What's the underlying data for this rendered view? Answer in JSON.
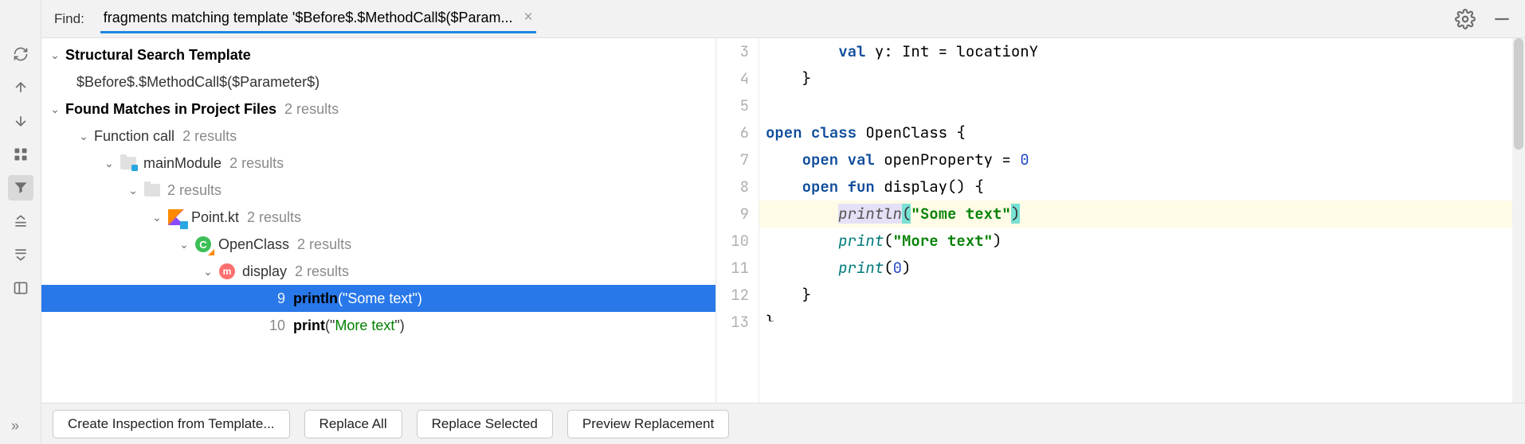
{
  "find": {
    "label": "Find:",
    "query": "fragments matching template '$Before$.$MethodCall$($Param..."
  },
  "tree": {
    "template_header": "Structural Search Template",
    "template_text": "$Before$.$MethodCall$($Parameter$)",
    "found_header": "Found Matches in Project Files",
    "found_count": "2 results",
    "nodes": {
      "function_call": {
        "label": "Function call",
        "count": "2 results"
      },
      "module": {
        "label": "mainModule",
        "count": "2 results"
      },
      "folder": {
        "label": "",
        "count": "2 results"
      },
      "file": {
        "label": "Point.kt",
        "count": "2 results"
      },
      "class": {
        "label": "OpenClass",
        "count": "2 results"
      },
      "method": {
        "label": "display",
        "count": "2 results"
      },
      "match1": {
        "line": "9",
        "fn": "println",
        "arg_open": "(\"",
        "arg": "Some text",
        "arg_close": "\")"
      },
      "match2": {
        "line": "10",
        "fn": "print",
        "arg_open": "(\"",
        "arg": "More text",
        "arg_close": "\")"
      }
    }
  },
  "editor": {
    "lines": [
      {
        "n": "3",
        "indent": "        ",
        "raw": "val y: Int = locationY",
        "tokens": [
          [
            "kw",
            "val "
          ],
          [
            "type",
            "y: Int "
          ],
          [
            "punct",
            "= locationY"
          ]
        ]
      },
      {
        "n": "4",
        "indent": "    ",
        "tokens": [
          [
            "punct",
            "}"
          ]
        ]
      },
      {
        "n": "5",
        "indent": "",
        "tokens": []
      },
      {
        "n": "6",
        "indent": "",
        "tokens": [
          [
            "kw",
            "open class "
          ],
          [
            "type",
            "OpenClass "
          ],
          [
            "punct",
            "{"
          ]
        ]
      },
      {
        "n": "7",
        "indent": "    ",
        "tokens": [
          [
            "kw",
            "open val "
          ],
          [
            "type",
            "openProperty "
          ],
          [
            "punct",
            "= "
          ],
          [
            "num-lit",
            "0"
          ]
        ]
      },
      {
        "n": "8",
        "indent": "    ",
        "tokens": [
          [
            "kw",
            "open fun "
          ],
          [
            "type",
            "display"
          ],
          [
            "punct",
            "() {"
          ]
        ]
      },
      {
        "n": "9",
        "indent": "        ",
        "hit": true,
        "tokens": [
          [
            "prop-hl",
            "println"
          ],
          [
            "paren-hl",
            "("
          ],
          [
            "str",
            "\"Some text\""
          ],
          [
            "paren-hl",
            ")"
          ]
        ]
      },
      {
        "n": "10",
        "indent": "        ",
        "tokens": [
          [
            "fn",
            "print"
          ],
          [
            "punct",
            "("
          ],
          [
            "str",
            "\"More text\""
          ],
          [
            "punct",
            ")"
          ]
        ]
      },
      {
        "n": "11",
        "indent": "        ",
        "tokens": [
          [
            "fn",
            "print"
          ],
          [
            "punct",
            "("
          ],
          [
            "num-lit",
            "0"
          ],
          [
            "punct",
            ")"
          ]
        ]
      },
      {
        "n": "12",
        "indent": "    ",
        "tokens": [
          [
            "punct",
            "}"
          ]
        ]
      },
      {
        "n": "13",
        "indent": "",
        "tokens": [
          [
            "punct",
            "}"
          ]
        ],
        "partial": true
      }
    ]
  },
  "buttons": {
    "create_inspection": "Create Inspection from Template...",
    "replace_all": "Replace All",
    "replace_selected": "Replace Selected",
    "preview": "Preview Replacement"
  },
  "icons": {
    "class_letter": "C",
    "method_letter": "m"
  }
}
